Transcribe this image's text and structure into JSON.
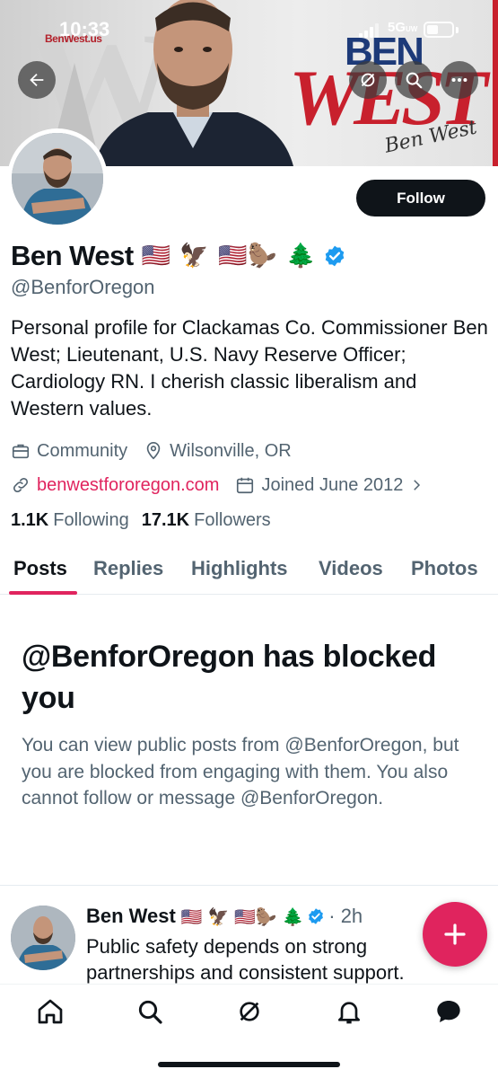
{
  "status_bar": {
    "time": "10:33",
    "network": "5G",
    "network_suffix": "UW"
  },
  "banner": {
    "small_logo": "BenWest.us",
    "logo_line1": "BEN",
    "logo_line2": "WEST",
    "signature": "Ben West"
  },
  "profile": {
    "follow_label": "Follow",
    "name": "Ben West",
    "name_emojis": "🇺🇸 🦅 🇺🇸🦫 🌲",
    "handle": "@BenforOregon",
    "bio": "Personal profile for Clackamas Co. Commissioner Ben West; Lieutenant, U.S. Navy Reserve Officer; Cardiology RN. I cherish classic liberalism and Western values.",
    "category": "Community",
    "location": "Wilsonville, OR",
    "website": "benwestfororegon.com",
    "joined": "Joined June 2012",
    "following_count": "1.1K",
    "following_label": "Following",
    "followers_count": "17.1K",
    "followers_label": "Followers"
  },
  "tabs": [
    "Posts",
    "Replies",
    "Highlights",
    "Videos",
    "Photos"
  ],
  "blocked": {
    "title": "@BenforOregon has blocked you",
    "text": "You can view public posts from @BenforOregon, but you are blocked from engaging with them. You also cannot follow or message @BenforOregon."
  },
  "post": {
    "name": "Ben West",
    "emojis": "🇺🇸 🦅 🇺🇸🦫 🌲",
    "time": "· 2h",
    "body": "Public safety depends on strong partnerships and consistent support."
  },
  "colors": {
    "accent": "#e0245e",
    "verified": "#1d9bf0",
    "text": "#0f1419",
    "muted": "#536471"
  }
}
